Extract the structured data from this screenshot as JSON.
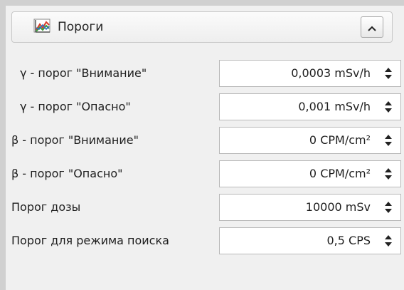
{
  "panel": {
    "title": "Пороги",
    "icon": "chart-icon",
    "collapse_icon": "chevron-up-icon"
  },
  "rows": [
    {
      "label": "γ - порог \"Внимание\"",
      "value": "0,0003 mSv/h"
    },
    {
      "label": "γ - порог \"Опасно\"",
      "value": "0,001 mSv/h"
    },
    {
      "label": "β - порог \"Внимание\"",
      "value": "0 CPM/cm²"
    },
    {
      "label": "β - порог \"Опасно\"",
      "value": "0 CPM/cm²"
    },
    {
      "label": "Порог дозы",
      "value": "10000 mSv"
    },
    {
      "label": "Порог для режима поиска",
      "value": "0,5 CPS"
    }
  ],
  "colors": {
    "panel_bg": "#f0f0f0",
    "frame": "#d0d0d0",
    "icon_red": "#d83a2a",
    "icon_blue": "#2f6fc0",
    "icon_green": "#3a9a3a"
  }
}
